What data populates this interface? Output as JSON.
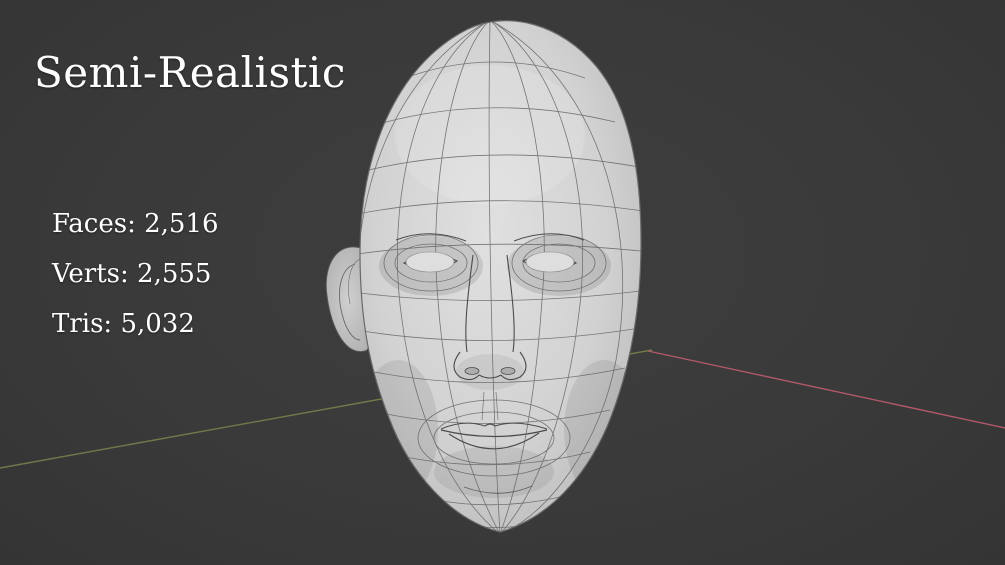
{
  "overlay": {
    "title": "Semi-Realistic",
    "text_color": "#ffffff",
    "stats": [
      {
        "label": "Faces",
        "value": "2,516",
        "text": "Faces: 2,516"
      },
      {
        "label": "Verts",
        "value": "2,555",
        "text": "Verts: 2,555"
      },
      {
        "label": "Tris",
        "value": "5,032",
        "text": "Tris: 5,032"
      }
    ]
  },
  "viewport": {
    "background_color": "#3a3a3a",
    "axis_colors": {
      "green": "#7d8c4e",
      "red": "#c75e72"
    },
    "model": "female-head-wireframe-mesh",
    "model_color": "#cfcfcf",
    "wire_color": "#5d5d5d"
  }
}
